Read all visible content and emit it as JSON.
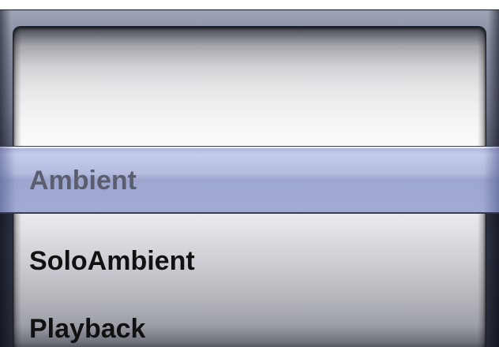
{
  "picker": {
    "selected": "Ambient",
    "options": [
      {
        "label": "Ambient"
      },
      {
        "label": "SoloAmbient"
      },
      {
        "label": "Playback"
      }
    ]
  },
  "colors": {
    "selection_bar": "#a6aed6",
    "row_text": "#111111",
    "selected_text": "#5a5e6f"
  }
}
